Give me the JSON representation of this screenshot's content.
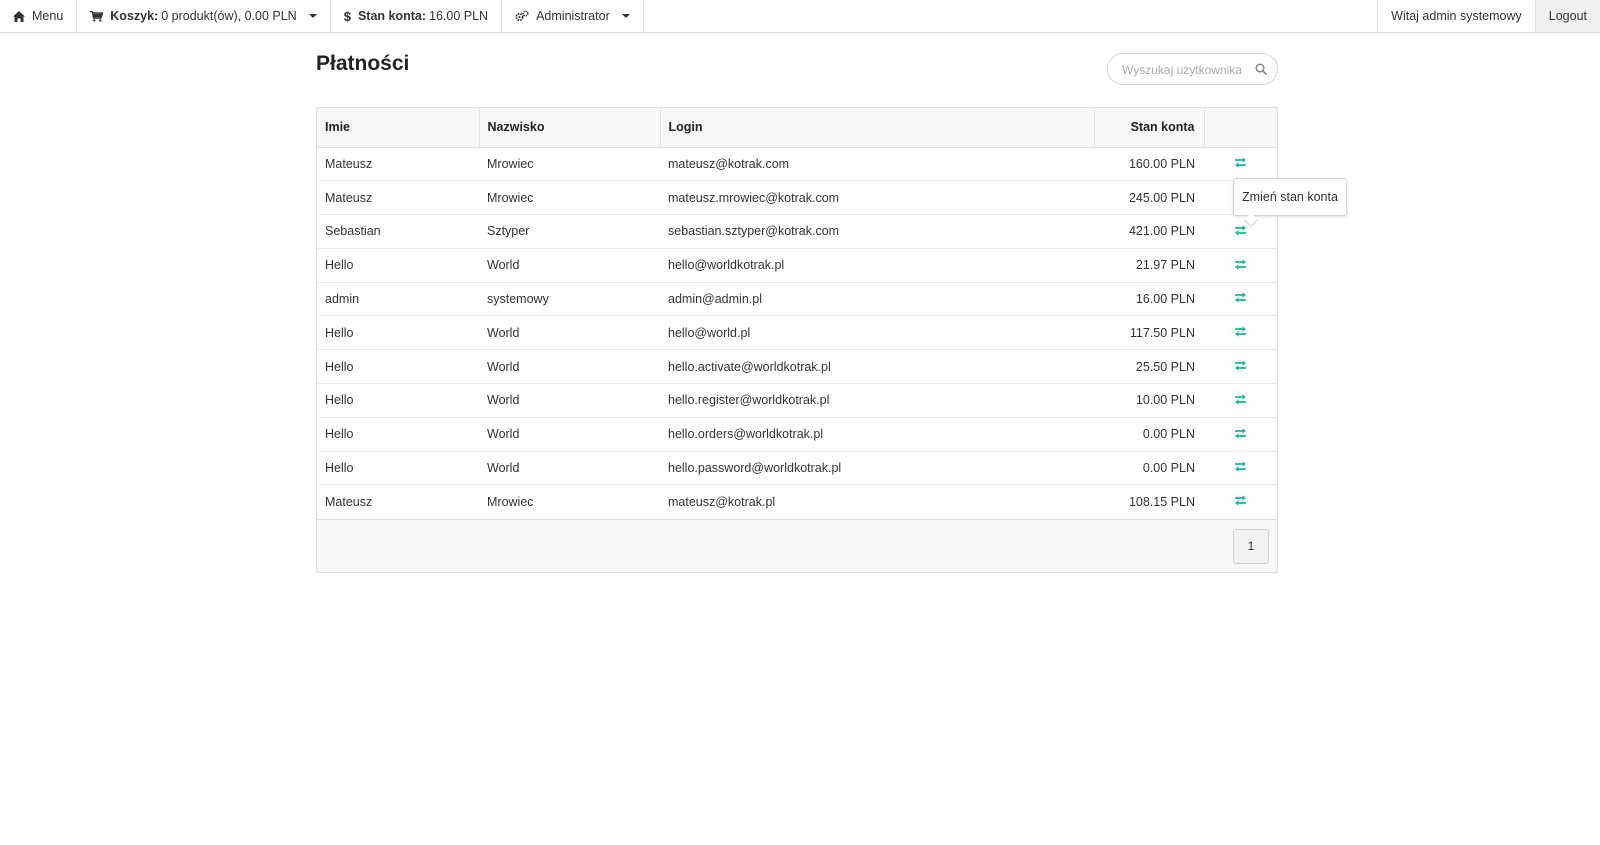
{
  "nav": {
    "menu_label": "Menu",
    "cart_label": "Koszyk:",
    "cart_value": "0 produkt(ów), 0.00 PLN",
    "balance_label": "Stan konta:",
    "balance_value": "16.00 PLN",
    "role_label": "Administrator",
    "welcome": "Witaj admin systemowy",
    "logout": "Logout"
  },
  "page": {
    "title": "Płatności"
  },
  "search": {
    "placeholder": "Wyszukaj użytkownika"
  },
  "table": {
    "headers": {
      "first_name": "Imie",
      "last_name": "Nazwisko",
      "login": "Login",
      "balance": "Stan konta"
    },
    "rows": [
      {
        "first_name": "Mateusz",
        "last_name": "Mrowiec",
        "login": "mateusz@kotrak.com",
        "balance": "160.00 PLN"
      },
      {
        "first_name": "Mateusz",
        "last_name": "Mrowiec",
        "login": "mateusz.mrowiec@kotrak.com",
        "balance": "245.00 PLN"
      },
      {
        "first_name": "Sebastian",
        "last_name": "Sztyper",
        "login": "sebastian.sztyper@kotrak.com",
        "balance": "421.00 PLN"
      },
      {
        "first_name": "Hello",
        "last_name": "World",
        "login": "hello@worldkotrak.pl",
        "balance": "21.97 PLN"
      },
      {
        "first_name": "admin",
        "last_name": "systemowy",
        "login": "admin@admin.pl",
        "balance": "16.00 PLN"
      },
      {
        "first_name": "Hello",
        "last_name": "World",
        "login": "hello@world.pl",
        "balance": "117.50 PLN"
      },
      {
        "first_name": "Hello",
        "last_name": "World",
        "login": "hello.activate@worldkotrak.pl",
        "balance": "25.50 PLN"
      },
      {
        "first_name": "Hello",
        "last_name": "World",
        "login": "hello.register@worldkotrak.pl",
        "balance": "10.00 PLN"
      },
      {
        "first_name": "Hello",
        "last_name": "World",
        "login": "hello.orders@worldkotrak.pl",
        "balance": "0.00 PLN"
      },
      {
        "first_name": "Hello",
        "last_name": "World",
        "login": "hello.password@worldkotrak.pl",
        "balance": "0.00 PLN"
      },
      {
        "first_name": "Mateusz",
        "last_name": "Mrowiec",
        "login": "mateusz@kotrak.pl",
        "balance": "108.15 PLN"
      }
    ],
    "action_icon": "transfer-arrows-icon",
    "action_color": "#1abc9c"
  },
  "pagination": {
    "current": "1"
  },
  "tooltip": {
    "text": "Zmień stan konta"
  }
}
